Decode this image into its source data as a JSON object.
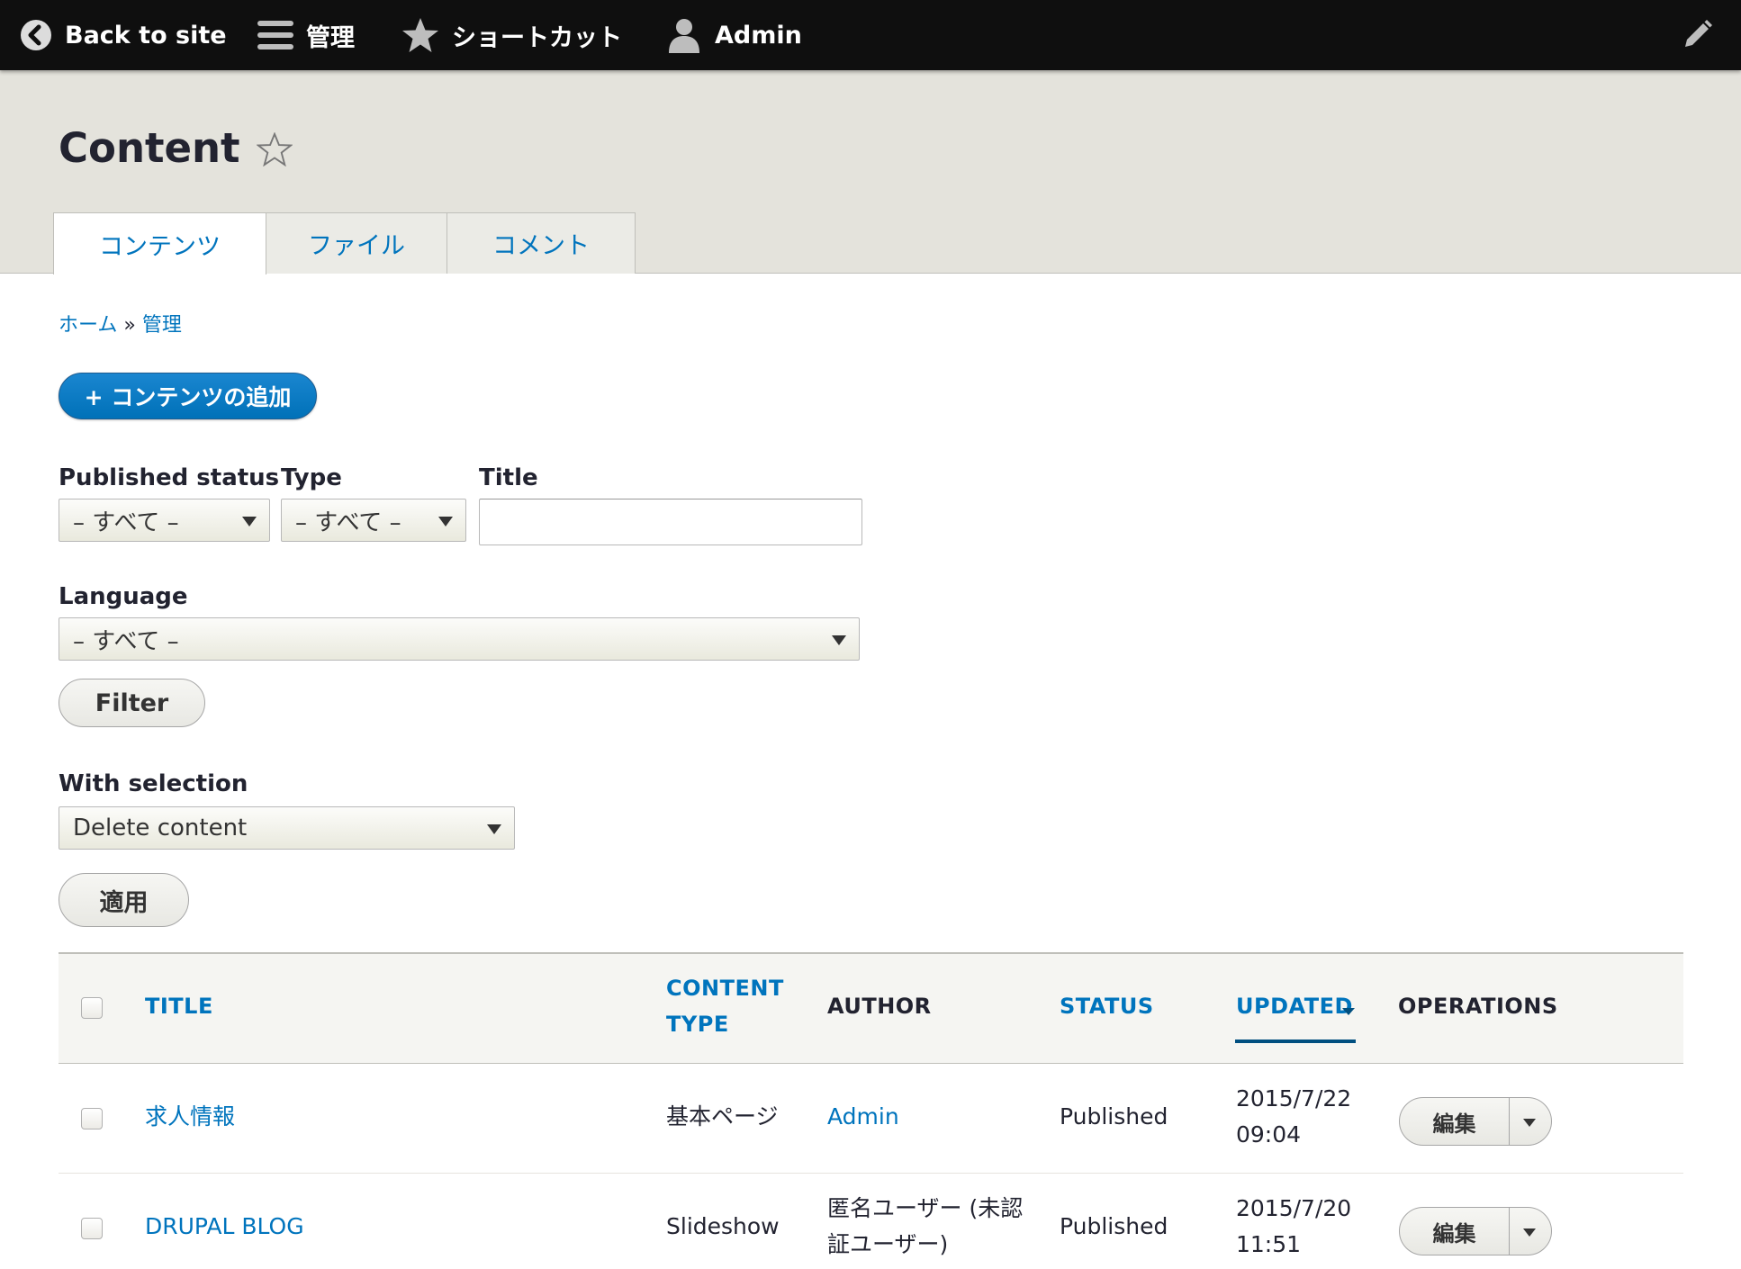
{
  "toolbar": {
    "back_label": "Back to site",
    "manage_label": "管理",
    "shortcuts_label": "ショートカット",
    "user_label": "Admin"
  },
  "header": {
    "title": "Content",
    "tabs": [
      {
        "label": "コンテンツ",
        "active": true
      },
      {
        "label": "ファイル",
        "active": false
      },
      {
        "label": "コメント",
        "active": false
      }
    ]
  },
  "breadcrumb": {
    "home": "ホーム",
    "separator": "»",
    "admin": "管理"
  },
  "actions": {
    "add_content": "+ コンテンツの追加"
  },
  "filters": {
    "status_label": "Published status",
    "status_value": "– すべて –",
    "type_label": "Type",
    "type_value": "– すべて –",
    "title_label": "Title",
    "title_value": "",
    "language_label": "Language",
    "language_value": "– すべて –",
    "filter_button": "Filter"
  },
  "bulk": {
    "label": "With selection",
    "value": "Delete content",
    "apply_button": "適用"
  },
  "table": {
    "headers": {
      "title": "TITLE",
      "content_type_line1": "CONTENT",
      "content_type_line2": "TYPE",
      "author": "AUTHOR",
      "status": "STATUS",
      "updated": "UPDATED",
      "operations": "OPERATIONS"
    },
    "rows": [
      {
        "title": "求人情報",
        "type": "基本ページ",
        "author_line1": "Admin",
        "author_line2": "",
        "status": "Published",
        "updated_date": "2015/7/22",
        "updated_time": "09:04",
        "operation": "編集"
      },
      {
        "title": "DRUPAL BLOG",
        "type": "Slideshow",
        "author_line1": "匿名ユーザー (未認",
        "author_line2": "証ユーザー)",
        "status": "Published",
        "updated_date": "2015/7/20",
        "updated_time": "11:51",
        "operation": "編集"
      }
    ]
  },
  "colors": {
    "toolbar_bg": "#0f0f0f",
    "header_bg": "#e4e3dc",
    "link": "#0074bd",
    "primary_button": "#0071b8"
  }
}
